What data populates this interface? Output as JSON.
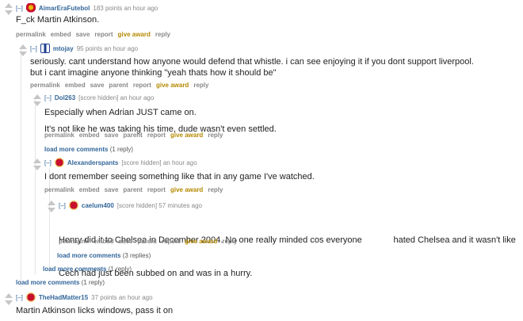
{
  "comments": [
    {
      "expand": "[–]",
      "author": "AimarEraFutebol",
      "meta": "183 points an hour ago",
      "flair_icon": "benfica-crest-icon",
      "body": [
        "F_ck Martin Atkinson."
      ],
      "buttons": [
        "permalink",
        "embed",
        "save",
        "report",
        "give award",
        "reply"
      ]
    },
    {
      "expand": "[–]",
      "author": "mtojay",
      "meta": "95 points an hour ago",
      "flair_icon": "psg-crest-icon",
      "body": [
        "seriously. cant understand how anyone would defend that whistle. i can see enjoying it if you dont support liverpool.",
        "but i cant imagine anyone thinking \"yeah thats how it should be\""
      ],
      "buttons": [
        "permalink",
        "embed",
        "save",
        "parent",
        "report",
        "give award",
        "reply"
      ]
    },
    {
      "expand": "[–]",
      "author": "Dol263",
      "meta": "[score hidden] an hour ago",
      "flair_icon": "",
      "body": [
        "Especially when Adrian JUST came on.",
        "It's not like he was taking his time, dude wasn't even settled."
      ],
      "buttons": [
        "permalink",
        "embed",
        "save",
        "parent",
        "report",
        "give award",
        "reply"
      ]
    },
    {
      "expand": "[–]",
      "author": "Alexanderspants",
      "meta": "[score hidden] an hour ago",
      "flair_icon": "liverpool-crest-icon",
      "body": [
        "I dont remember seeing something like that in any game I've watched."
      ],
      "buttons": [
        "permalink",
        "embed",
        "save",
        "parent",
        "report",
        "give award",
        "reply"
      ]
    },
    {
      "expand": "[–]",
      "author": "caelum400",
      "meta": "[score hidden] 57 minutes ago",
      "flair_icon": "liverpool-crest-icon",
      "body": [
        "Henry did it to Chelsea in December 2004. No one really minded cos everyone             hated Chelsea and it wasn't like",
        "Cech had just been subbed on and was in a hurry."
      ],
      "buttons": [
        "permalink",
        "embed",
        "save",
        "parent",
        "report",
        "give award",
        "reply"
      ]
    },
    {
      "expand": "[–]",
      "author": "TheHadMatter15",
      "meta": "37 points an hour ago",
      "flair_icon": "liverpool-crest-icon",
      "body": [
        "Martin Atkinson licks windows, pass it on"
      ],
      "buttons": []
    }
  ],
  "load_more": [
    {
      "label": "load more comments",
      "count": "(1 reply)"
    },
    {
      "label": "load more comments",
      "count": "(3 replies)"
    },
    {
      "label": "load more comments",
      "count": "(1 reply)"
    },
    {
      "label": "load more comments",
      "count": "(1 reply)"
    }
  ],
  "colors": {
    "username": "#336699",
    "give_award": "#b58900",
    "meta": "#888888"
  }
}
